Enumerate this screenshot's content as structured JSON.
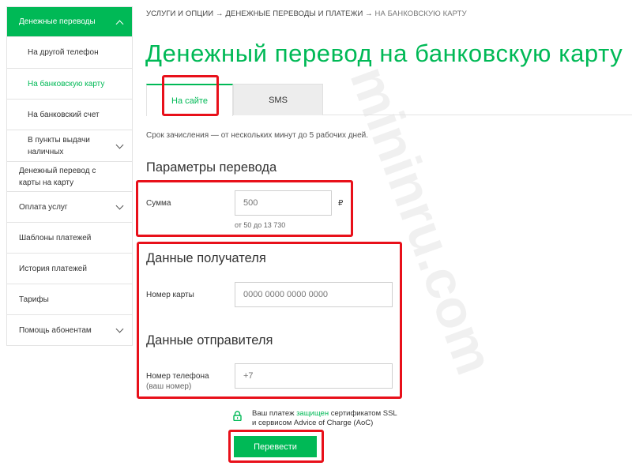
{
  "sidebar": {
    "items": [
      {
        "label": "Денежные переводы"
      },
      {
        "label": "На другой телефон"
      },
      {
        "label": "На банковскую карту"
      },
      {
        "label": "На банковский счет"
      },
      {
        "label": "В пункты выдачи наличных"
      },
      {
        "label": "Денежный перевод с карты на карту"
      },
      {
        "label": "Оплата услуг"
      },
      {
        "label": "Шаблоны платежей"
      },
      {
        "label": "История платежей"
      },
      {
        "label": "Тарифы"
      },
      {
        "label": "Помощь абонентам"
      }
    ]
  },
  "breadcrumb": {
    "item1": "УСЛУГИ И ОПЦИИ",
    "sep": "→",
    "item2": "ДЕНЕЖНЫЕ ПЕРЕВОДЫ И ПЛАТЕЖИ",
    "item3": "НА БАНКОВСКУЮ КАРТУ"
  },
  "page_title": "Денежный перевод на банковскую карту",
  "tabs": [
    {
      "label": "На сайте",
      "active": true
    },
    {
      "label": "SMS",
      "active": false
    }
  ],
  "note": "Срок зачисления — от нескольких минут до 5 рабочих дней.",
  "transfer_params": {
    "title": "Параметры перевода",
    "amount_label": "Сумма",
    "amount_placeholder": "500",
    "currency": "₽",
    "hint": "от 50 до 13 730"
  },
  "recipient": {
    "title": "Данные получателя",
    "card_label": "Номер карты",
    "card_placeholder": "0000 0000 0000 0000"
  },
  "sender": {
    "title": "Данные отправителя",
    "phone_label": "Номер телефона",
    "phone_sublabel": "(ваш номер)",
    "phone_placeholder": "+7"
  },
  "security": {
    "prefix": "Ваш платеж ",
    "link": "защищен",
    "suffix": " сертификатом SSL",
    "line2": "и сервисом Advice of Charge (AoC)"
  },
  "submit_label": "Перевести",
  "watermark": "mininru.com",
  "colors": {
    "accent": "#00b956",
    "highlight": "#e8101a"
  },
  "icons": [
    "chevron-up-icon",
    "chevron-down-icon",
    "lock-icon"
  ]
}
